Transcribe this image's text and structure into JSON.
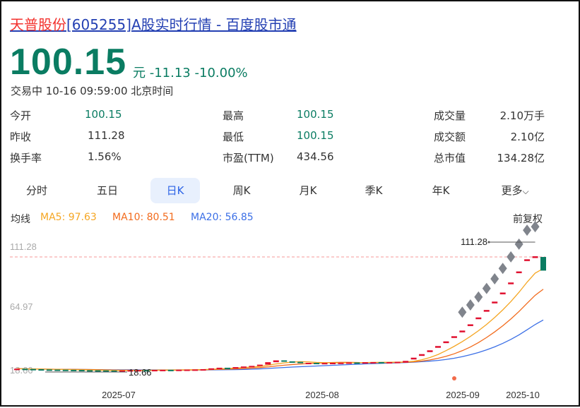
{
  "header": {
    "name": "天普股份",
    "rest": "[605255]A股实时行情 - 百度股市通"
  },
  "quote": {
    "price": "100.15",
    "unit": "元",
    "change": "-11.13",
    "pct": "-10.00%",
    "status": "交易中 10-16 09:59:00 北京时间"
  },
  "stats": [
    {
      "label": "今开",
      "value": "100.15",
      "green": true
    },
    {
      "label": "最高",
      "value": "100.15",
      "green": true
    },
    {
      "label": "成交量",
      "value": "2.10万手"
    },
    {
      "label": "昨收",
      "value": "111.28"
    },
    {
      "label": "最低",
      "value": "100.15",
      "green": true
    },
    {
      "label": "成交额",
      "value": "2.10亿"
    },
    {
      "label": "换手率",
      "value": "1.56%"
    },
    {
      "label": "市盈(TTM)",
      "value": "434.56"
    },
    {
      "label": "总市值",
      "value": "134.28亿"
    }
  ],
  "tabs": [
    "分时",
    "五日",
    "日K",
    "周K",
    "月K",
    "季K",
    "年K",
    "更多"
  ],
  "active_tab": "日K",
  "ma": {
    "label": "均线",
    "ma5": "MA5: 97.63",
    "ma10": "MA10: 80.51",
    "ma20": "MA20: 56.85",
    "adjust": "前复权"
  },
  "colors": {
    "up": "#e0102f",
    "down": "#0a7c62",
    "ma5": "#f5a623",
    "ma10": "#f26b1d",
    "ma20": "#3b6fe6"
  },
  "chart_data": {
    "type": "candlestick",
    "y_labels": [
      "111.28",
      "64.97",
      "18.66"
    ],
    "x_labels": [
      "2025-07",
      "2025-08",
      "2025-09",
      "2025-10"
    ],
    "high_mark": "111.28",
    "low_mark": "18.66",
    "prev_close": 111.28,
    "closes": [
      20.2,
      20,
      19.8,
      19.6,
      19.5,
      19.4,
      19.3,
      19.2,
      19,
      18.9,
      18.8,
      18.7,
      18.66,
      18.8,
      19,
      19.1,
      19,
      19.2,
      19.3,
      19.2,
      19.4,
      19.5,
      19.6,
      19.8,
      20.5,
      21,
      20.8,
      21.5,
      22,
      22.5,
      23.5,
      25.5,
      27,
      26.2,
      25.8,
      25,
      25,
      24.8,
      24.9,
      25,
      25.1,
      25.3,
      25.2,
      25.5,
      25.6,
      25.4,
      25.6,
      25.8,
      26,
      28.6,
      31.5,
      34.6,
      38.1,
      41.9,
      46.1,
      50.7,
      55.8,
      61.4,
      67.5,
      74.3,
      81.7,
      89.9,
      98.9,
      108.8,
      111.28,
      100.15
    ]
  }
}
